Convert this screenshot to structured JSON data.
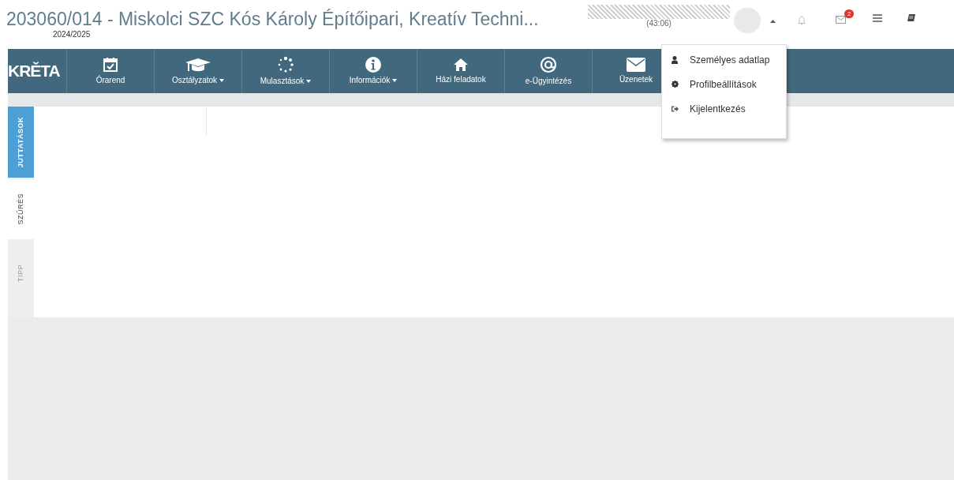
{
  "header": {
    "title": "203060/014 - Miskolci SZC Kós Károly Építőipari, Kreatív Techni...",
    "school_year": "2024/2025",
    "session_time": "(43:06)",
    "unread_messages": "2"
  },
  "logo": "KRĚTA",
  "nav": [
    {
      "label": "Órarend",
      "kind": "calendar",
      "has_menu": false
    },
    {
      "label": "Osztályzatok",
      "kind": "graduation",
      "has_menu": true
    },
    {
      "label": "Mulasztások",
      "kind": "dots",
      "has_menu": true
    },
    {
      "label": "Információk",
      "kind": "info",
      "has_menu": true
    },
    {
      "label": "Házi feladatok",
      "kind": "home",
      "has_menu": false
    },
    {
      "label": "e-Ügyintézés",
      "kind": "at",
      "has_menu": false
    },
    {
      "label": "Üzenetek",
      "kind": "mail",
      "has_menu": false
    }
  ],
  "user_menu": [
    {
      "label": "Személyes adatlap",
      "kind": "user"
    },
    {
      "label": "Profilbeállítások",
      "kind": "gear"
    },
    {
      "label": "Kijelentkezés",
      "kind": "logout"
    }
  ],
  "side_tabs": [
    {
      "label": "JUTTATÁSOK",
      "selected": true,
      "disabled": false
    },
    {
      "label": "SZŰRÉS",
      "selected": false,
      "disabled": false
    },
    {
      "label": "TIPP",
      "selected": false,
      "disabled": true
    }
  ]
}
